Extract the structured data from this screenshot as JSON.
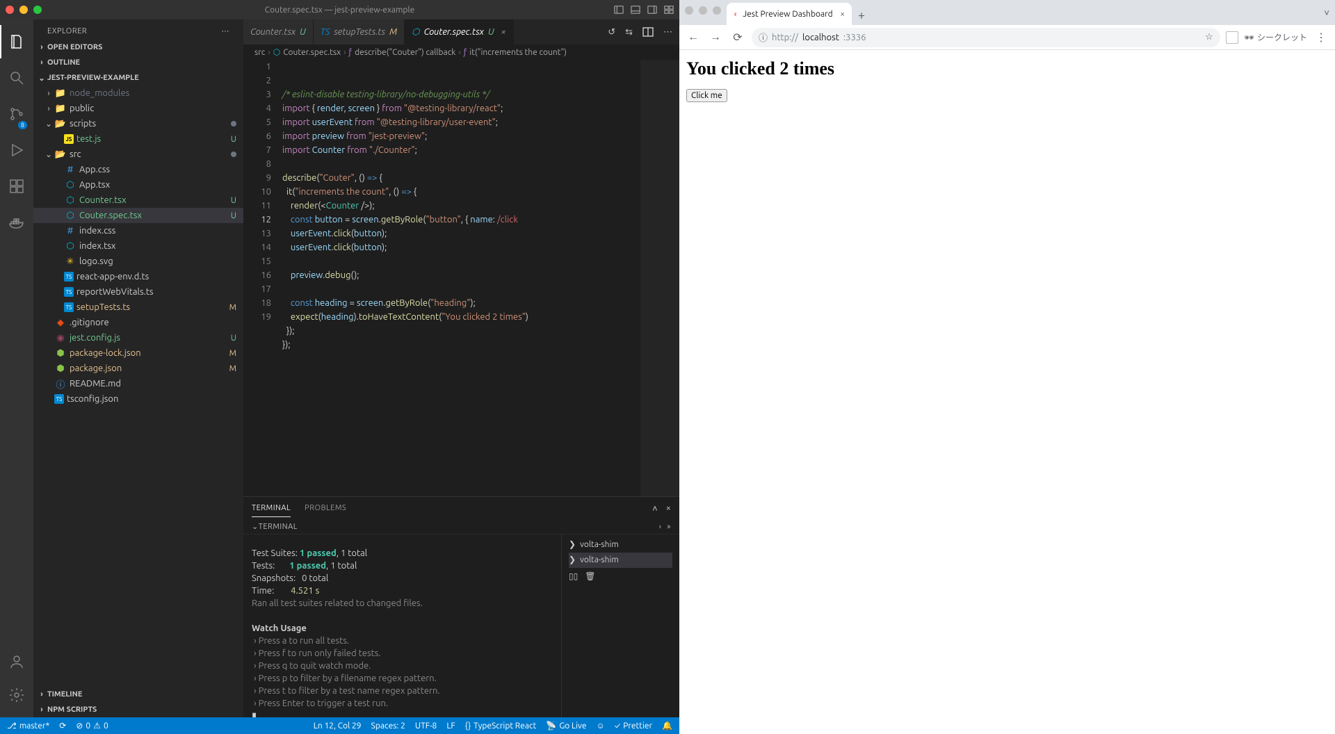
{
  "vscode": {
    "window_title": "Couter.spec.tsx — jest-preview-example",
    "sidebar": {
      "title": "EXPLORER",
      "sections": {
        "open_editors": "OPEN EDITORS",
        "outline": "OUTLINE",
        "root": "JEST-PREVIEW-EXAMPLE",
        "timeline": "TIMELINE",
        "npm_scripts": "NPM SCRIPTS"
      },
      "tree": {
        "folders": {
          "node_modules": "node_modules",
          "public": "public",
          "scripts": "scripts",
          "src": "src"
        },
        "files": {
          "testjs": "test.js",
          "appcss": "App.css",
          "apptsx": "App.tsx",
          "countertsx": "Counter.tsx",
          "couterspec": "Couter.spec.tsx",
          "indexcss": "index.css",
          "indextsx": "index.tsx",
          "logosvg": "logo.svg",
          "reactenv": "react-app-env.d.ts",
          "reportvitals": "reportWebVitals.ts",
          "setuptests": "setupTests.ts",
          "gitignore": ".gitignore",
          "jestconfig": "jest.config.js",
          "pkglock": "package-lock.json",
          "pkg": "package.json",
          "readme": "README.md",
          "tsconfig": "tsconfig.json"
        },
        "status": {
          "testjs": "U",
          "countertsx": "U",
          "couterspec": "U",
          "setuptests": "M",
          "jestconfig": "U",
          "pkglock": "M",
          "pkg": "M"
        }
      }
    },
    "scm_badge": "8",
    "tabs": [
      {
        "label": "Counter.tsx",
        "status": "U",
        "active": false
      },
      {
        "label": "setupTests.ts",
        "status": "M",
        "active": false
      },
      {
        "label": "Couter.spec.tsx",
        "status": "U",
        "active": true
      }
    ],
    "breadcrumb": [
      "src",
      "Couter.spec.tsx",
      "describe(\"Couter\") callback",
      "it(\"increments the count\")"
    ],
    "editor": {
      "line_nums": [
        "1",
        "2",
        "3",
        "4",
        "5",
        "6",
        "7",
        "8",
        "9",
        "10",
        "11",
        "12",
        "13",
        "14",
        "15",
        "16",
        "17",
        "18",
        "19"
      ]
    },
    "panel": {
      "tabs": {
        "terminal": "TERMINAL",
        "problems": "PROBLEMS"
      },
      "sub": "TERMINAL",
      "side": [
        "volta-shim",
        "volta-shim"
      ],
      "out": {
        "suites_label": "Test Suites:",
        "tests_label": "Tests:",
        "snapshots_label": "Snapshots:",
        "time_label": "Time:",
        "passed1": "1 passed",
        "total1": ", 1 total",
        "snapshots": "0 total",
        "time": "4.521 s",
        "ran": "Ran all test suites related to changed files.",
        "watch_heading": "Watch Usage",
        "usage": [
          " › Press a to run all tests.",
          " › Press f to run only failed tests.",
          " › Press q to quit watch mode.",
          " › Press p to filter by a filename regex pattern.",
          " › Press t to filter by a test name regex pattern.",
          " › Press Enter to trigger a test run."
        ],
        "cursor": "▮"
      }
    },
    "statusbar": {
      "branch": "master*",
      "errors": "0",
      "warnings": "0",
      "ln_col": "Ln 12, Col 29",
      "spaces": "Spaces: 2",
      "encoding": "UTF-8",
      "eol": "LF",
      "lang": "TypeScript React",
      "golive": "Go Live",
      "prettier": "Prettier"
    }
  },
  "browser": {
    "tab_title": "Jest Preview Dashboard",
    "url_prefix": "http://",
    "url_host": "localhost",
    "url_port": ":3336",
    "incognito": "シークレット",
    "page": {
      "heading": "You clicked 2 times",
      "button": "Click me"
    }
  }
}
